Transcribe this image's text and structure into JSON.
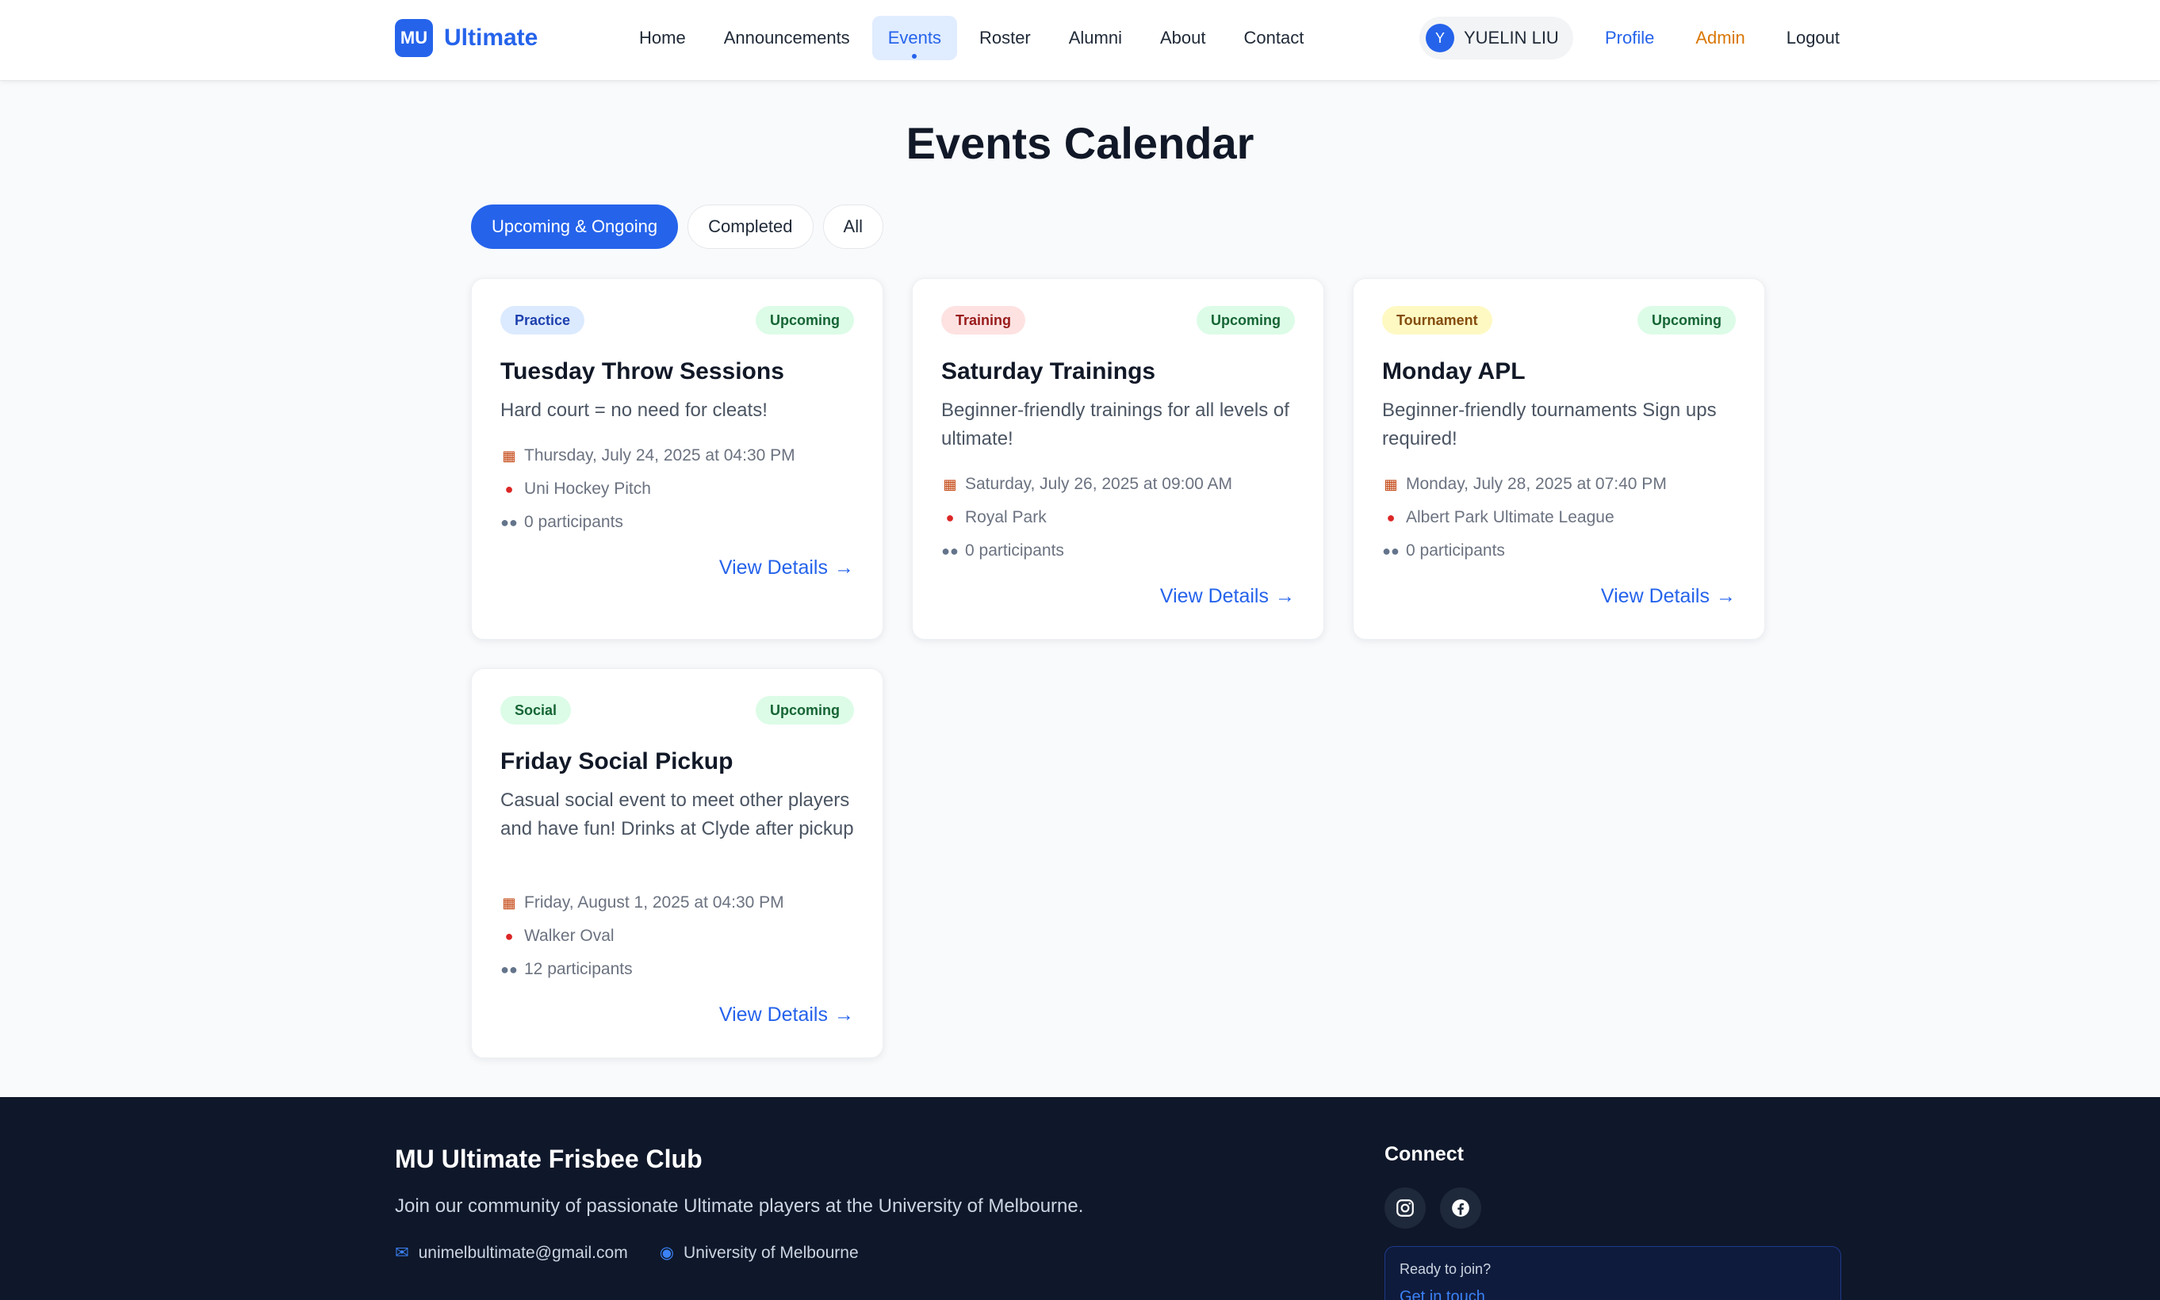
{
  "brand": {
    "badge": "MU",
    "name": "Ultimate"
  },
  "nav": {
    "links": [
      "Home",
      "Announcements",
      "Events",
      "Roster",
      "Alumni",
      "About",
      "Contact"
    ],
    "active": "Events",
    "user_initial": "Y",
    "user_name": "YUELIN LIU",
    "profile": "Profile",
    "admin": "Admin",
    "logout": "Logout"
  },
  "page": {
    "title": "Events Calendar"
  },
  "filters": [
    "Upcoming & Ongoing",
    "Completed",
    "All"
  ],
  "active_filter": "Upcoming & Ongoing",
  "events": [
    {
      "type": "Practice",
      "status": "Upcoming",
      "title": "Tuesday Throw Sessions",
      "description": "Hard court = no need for cleats!",
      "date": "Thursday, July 24, 2025 at 04:30 PM",
      "location": "Uni Hockey Pitch",
      "participants": "0 participants",
      "link": "View Details"
    },
    {
      "type": "Training",
      "status": "Upcoming",
      "title": "Saturday Trainings",
      "description": "Beginner-friendly trainings for all levels of ultimate!",
      "date": "Saturday, July 26, 2025 at 09:00 AM",
      "location": "Royal Park",
      "participants": "0 participants",
      "link": "View Details"
    },
    {
      "type": "Tournament",
      "status": "Upcoming",
      "title": "Monday APL",
      "description": "Beginner-friendly tournaments Sign ups required!",
      "date": "Monday, July 28, 2025 at 07:40 PM",
      "location": "Albert Park Ultimate League",
      "participants": "0 participants",
      "link": "View Details"
    },
    {
      "type": "Social",
      "status": "Upcoming",
      "title": "Friday Social Pickup",
      "description": "Casual social event to meet other players and have fun! Drinks at Clyde after pickup",
      "date": "Friday, August 1, 2025 at 04:30 PM",
      "location": "Walker Oval",
      "participants": "12 participants",
      "link": "View Details"
    }
  ],
  "icons": {
    "date": "calendar-icon",
    "location": "pin-icon",
    "participants": "people-icon",
    "arrow": "arrow-right-icon"
  },
  "footer": {
    "title": "MU Ultimate Frisbee Club",
    "description": "Join our community of passionate Ultimate players at the University of Melbourne.",
    "email": "unimelbultimate@gmail.com",
    "location": "University of Melbourne",
    "connect_title": "Connect",
    "join_label": "Ready to join?",
    "join_link": "Get in touch"
  },
  "colors": {
    "accent": "#2563eb",
    "admin": "#d97706",
    "footer_bg": "#0f172a"
  }
}
